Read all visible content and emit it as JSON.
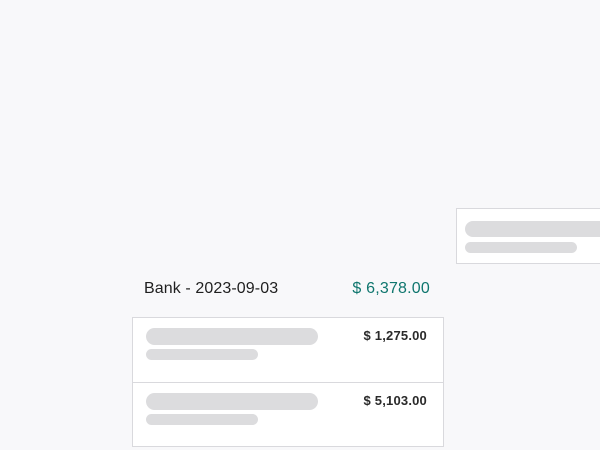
{
  "group": {
    "title": "Bank - 2023-09-03",
    "total": "$ 6,378.00",
    "total_color": "#0f766e"
  },
  "transactions": [
    {
      "amount": "$ 1,275.00"
    },
    {
      "amount": "$ 5,103.00"
    }
  ]
}
